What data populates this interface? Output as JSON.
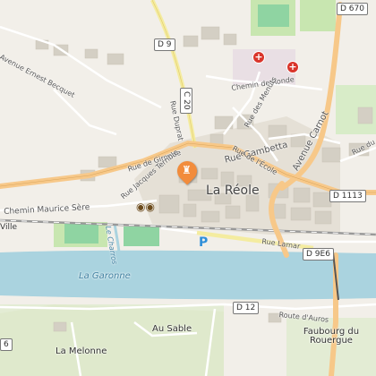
{
  "map": {
    "town": "La Réole",
    "river": "La Garonne",
    "canal": "Le Charros",
    "streets": {
      "avenue_ernest_becquet": "Avenue Ernest Becquet",
      "rue_duprat": "Rue Duprat",
      "rue_gambetta": "Rue Gambetta",
      "rue_de_gironde": "Rue de Gironde",
      "rue_jacques_terrible": "Rue Jacques Terrible",
      "chemin_maurice_sere": "Chemin Maurice Sère",
      "rue_lamar": "Rue Lamar",
      "chemin_de_ronde": "Chemin de Ronde",
      "rue_des_menuts": "Rue des Menuts",
      "rue_de_l_ecole": "Rue de l'École",
      "avenue_carnot": "Avenue Carnot",
      "rue_du": "Rue du",
      "route_d_auros": "Route d'Auros"
    },
    "road_refs": {
      "d9": "D 9",
      "c20": "C 20",
      "d670": "D 670",
      "d1113": "D 1113",
      "d9e6": "D 9E6",
      "d12": "D 12"
    },
    "places": {
      "au_sable": "Au Sable",
      "la_melonne": "La Melonne",
      "faubourg": "Faubourg du Rouergue",
      "ville_partial": "Ville",
      "edge_6": "6"
    },
    "icons": {
      "parking": "P",
      "medical": "+",
      "poi_pin": "tower-icon",
      "viewpoint": "binoculars-icon"
    },
    "colors": {
      "land": "#f2efe9",
      "water": "#aad3df",
      "major_road": "#f7c889",
      "secondary_road": "#f4eca0",
      "pin": "#f28c3c",
      "green": "#c8e6b0"
    }
  }
}
